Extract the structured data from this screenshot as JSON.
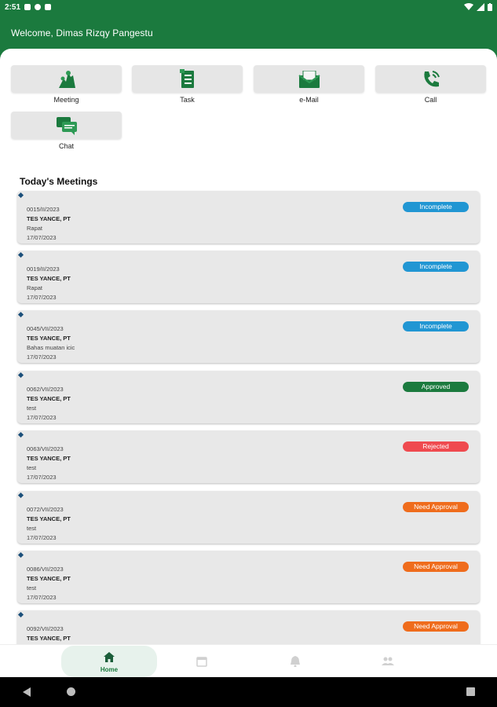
{
  "status_bar": {
    "time": "2:51"
  },
  "header": {
    "welcome": "Welcome, Dimas Rizqy Pangestu"
  },
  "quick_actions": [
    {
      "label": "Meeting",
      "icon": "meeting-icon"
    },
    {
      "label": "Task",
      "icon": "task-icon"
    },
    {
      "label": "e-Mail",
      "icon": "email-icon"
    },
    {
      "label": "Call",
      "icon": "call-icon"
    },
    {
      "label": "Chat",
      "icon": "chat-icon"
    }
  ],
  "meetings_title": "Today's Meetings",
  "meetings": [
    {
      "number": "0015/II/2023",
      "company": "TES YANCE, PT",
      "subject": "Rapat",
      "date": "17/07/2023",
      "status": "Incomplete"
    },
    {
      "number": "0019/II/2023",
      "company": "TES YANCE, PT",
      "subject": "Rapat",
      "date": "17/07/2023",
      "status": "Incomplete"
    },
    {
      "number": "0045/VII/2023",
      "company": "TES YANCE, PT",
      "subject": "Bahas muatan icic",
      "date": "17/07/2023",
      "status": "Incomplete"
    },
    {
      "number": "0062/VII/2023",
      "company": "TES YANCE, PT",
      "subject": "test",
      "date": "17/07/2023",
      "status": "Approved"
    },
    {
      "number": "0063/VII/2023",
      "company": "TES YANCE, PT",
      "subject": "test",
      "date": "17/07/2023",
      "status": "Rejected"
    },
    {
      "number": "0072/VII/2023",
      "company": "TES YANCE, PT",
      "subject": "test",
      "date": "17/07/2023",
      "status": "Need Approval"
    },
    {
      "number": "0086/VII/2023",
      "company": "TES YANCE, PT",
      "subject": "test",
      "date": "17/07/2023",
      "status": "Need Approval"
    },
    {
      "number": "0092/VII/2023",
      "company": "TES YANCE, PT",
      "subject": "",
      "date": "",
      "status": "Need Approval"
    }
  ],
  "status_colors": {
    "Incomplete": "#2196d3",
    "Approved": "#1b7a3e",
    "Rejected": "#ef4a4f",
    "Need Approval": "#ef6c1c"
  },
  "bottom_nav": [
    {
      "label": "Home",
      "icon": "home-icon",
      "active": true
    },
    {
      "label": "",
      "icon": "calendar-icon",
      "active": false
    },
    {
      "label": "",
      "icon": "notification-icon",
      "active": false
    },
    {
      "label": "",
      "icon": "people-icon",
      "active": false
    }
  ],
  "colors": {
    "primary": "#1b7a3e",
    "card": "#e8e8e8",
    "tile": "#e6e6e6"
  }
}
